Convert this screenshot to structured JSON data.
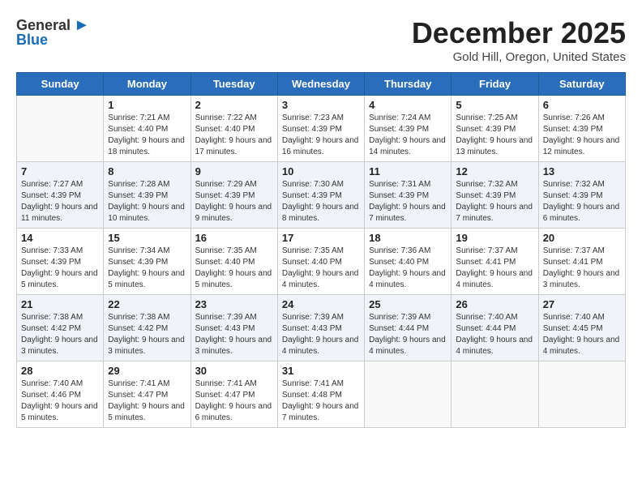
{
  "logo": {
    "general": "General",
    "blue": "Blue"
  },
  "title": "December 2025",
  "location": "Gold Hill, Oregon, United States",
  "days_of_week": [
    "Sunday",
    "Monday",
    "Tuesday",
    "Wednesday",
    "Thursday",
    "Friday",
    "Saturday"
  ],
  "weeks": [
    [
      {
        "day": "",
        "sunrise": "",
        "sunset": "",
        "daylight": ""
      },
      {
        "day": "1",
        "sunrise": "Sunrise: 7:21 AM",
        "sunset": "Sunset: 4:40 PM",
        "daylight": "Daylight: 9 hours and 18 minutes."
      },
      {
        "day": "2",
        "sunrise": "Sunrise: 7:22 AM",
        "sunset": "Sunset: 4:40 PM",
        "daylight": "Daylight: 9 hours and 17 minutes."
      },
      {
        "day": "3",
        "sunrise": "Sunrise: 7:23 AM",
        "sunset": "Sunset: 4:39 PM",
        "daylight": "Daylight: 9 hours and 16 minutes."
      },
      {
        "day": "4",
        "sunrise": "Sunrise: 7:24 AM",
        "sunset": "Sunset: 4:39 PM",
        "daylight": "Daylight: 9 hours and 14 minutes."
      },
      {
        "day": "5",
        "sunrise": "Sunrise: 7:25 AM",
        "sunset": "Sunset: 4:39 PM",
        "daylight": "Daylight: 9 hours and 13 minutes."
      },
      {
        "day": "6",
        "sunrise": "Sunrise: 7:26 AM",
        "sunset": "Sunset: 4:39 PM",
        "daylight": "Daylight: 9 hours and 12 minutes."
      }
    ],
    [
      {
        "day": "7",
        "sunrise": "Sunrise: 7:27 AM",
        "sunset": "Sunset: 4:39 PM",
        "daylight": "Daylight: 9 hours and 11 minutes."
      },
      {
        "day": "8",
        "sunrise": "Sunrise: 7:28 AM",
        "sunset": "Sunset: 4:39 PM",
        "daylight": "Daylight: 9 hours and 10 minutes."
      },
      {
        "day": "9",
        "sunrise": "Sunrise: 7:29 AM",
        "sunset": "Sunset: 4:39 PM",
        "daylight": "Daylight: 9 hours and 9 minutes."
      },
      {
        "day": "10",
        "sunrise": "Sunrise: 7:30 AM",
        "sunset": "Sunset: 4:39 PM",
        "daylight": "Daylight: 9 hours and 8 minutes."
      },
      {
        "day": "11",
        "sunrise": "Sunrise: 7:31 AM",
        "sunset": "Sunset: 4:39 PM",
        "daylight": "Daylight: 9 hours and 7 minutes."
      },
      {
        "day": "12",
        "sunrise": "Sunrise: 7:32 AM",
        "sunset": "Sunset: 4:39 PM",
        "daylight": "Daylight: 9 hours and 7 minutes."
      },
      {
        "day": "13",
        "sunrise": "Sunrise: 7:32 AM",
        "sunset": "Sunset: 4:39 PM",
        "daylight": "Daylight: 9 hours and 6 minutes."
      }
    ],
    [
      {
        "day": "14",
        "sunrise": "Sunrise: 7:33 AM",
        "sunset": "Sunset: 4:39 PM",
        "daylight": "Daylight: 9 hours and 5 minutes."
      },
      {
        "day": "15",
        "sunrise": "Sunrise: 7:34 AM",
        "sunset": "Sunset: 4:39 PM",
        "daylight": "Daylight: 9 hours and 5 minutes."
      },
      {
        "day": "16",
        "sunrise": "Sunrise: 7:35 AM",
        "sunset": "Sunset: 4:40 PM",
        "daylight": "Daylight: 9 hours and 5 minutes."
      },
      {
        "day": "17",
        "sunrise": "Sunrise: 7:35 AM",
        "sunset": "Sunset: 4:40 PM",
        "daylight": "Daylight: 9 hours and 4 minutes."
      },
      {
        "day": "18",
        "sunrise": "Sunrise: 7:36 AM",
        "sunset": "Sunset: 4:40 PM",
        "daylight": "Daylight: 9 hours and 4 minutes."
      },
      {
        "day": "19",
        "sunrise": "Sunrise: 7:37 AM",
        "sunset": "Sunset: 4:41 PM",
        "daylight": "Daylight: 9 hours and 4 minutes."
      },
      {
        "day": "20",
        "sunrise": "Sunrise: 7:37 AM",
        "sunset": "Sunset: 4:41 PM",
        "daylight": "Daylight: 9 hours and 3 minutes."
      }
    ],
    [
      {
        "day": "21",
        "sunrise": "Sunrise: 7:38 AM",
        "sunset": "Sunset: 4:42 PM",
        "daylight": "Daylight: 9 hours and 3 minutes."
      },
      {
        "day": "22",
        "sunrise": "Sunrise: 7:38 AM",
        "sunset": "Sunset: 4:42 PM",
        "daylight": "Daylight: 9 hours and 3 minutes."
      },
      {
        "day": "23",
        "sunrise": "Sunrise: 7:39 AM",
        "sunset": "Sunset: 4:43 PM",
        "daylight": "Daylight: 9 hours and 3 minutes."
      },
      {
        "day": "24",
        "sunrise": "Sunrise: 7:39 AM",
        "sunset": "Sunset: 4:43 PM",
        "daylight": "Daylight: 9 hours and 4 minutes."
      },
      {
        "day": "25",
        "sunrise": "Sunrise: 7:39 AM",
        "sunset": "Sunset: 4:44 PM",
        "daylight": "Daylight: 9 hours and 4 minutes."
      },
      {
        "day": "26",
        "sunrise": "Sunrise: 7:40 AM",
        "sunset": "Sunset: 4:44 PM",
        "daylight": "Daylight: 9 hours and 4 minutes."
      },
      {
        "day": "27",
        "sunrise": "Sunrise: 7:40 AM",
        "sunset": "Sunset: 4:45 PM",
        "daylight": "Daylight: 9 hours and 4 minutes."
      }
    ],
    [
      {
        "day": "28",
        "sunrise": "Sunrise: 7:40 AM",
        "sunset": "Sunset: 4:46 PM",
        "daylight": "Daylight: 9 hours and 5 minutes."
      },
      {
        "day": "29",
        "sunrise": "Sunrise: 7:41 AM",
        "sunset": "Sunset: 4:47 PM",
        "daylight": "Daylight: 9 hours and 5 minutes."
      },
      {
        "day": "30",
        "sunrise": "Sunrise: 7:41 AM",
        "sunset": "Sunset: 4:47 PM",
        "daylight": "Daylight: 9 hours and 6 minutes."
      },
      {
        "day": "31",
        "sunrise": "Sunrise: 7:41 AM",
        "sunset": "Sunset: 4:48 PM",
        "daylight": "Daylight: 9 hours and 7 minutes."
      },
      {
        "day": "",
        "sunrise": "",
        "sunset": "",
        "daylight": ""
      },
      {
        "day": "",
        "sunrise": "",
        "sunset": "",
        "daylight": ""
      },
      {
        "day": "",
        "sunrise": "",
        "sunset": "",
        "daylight": ""
      }
    ]
  ]
}
